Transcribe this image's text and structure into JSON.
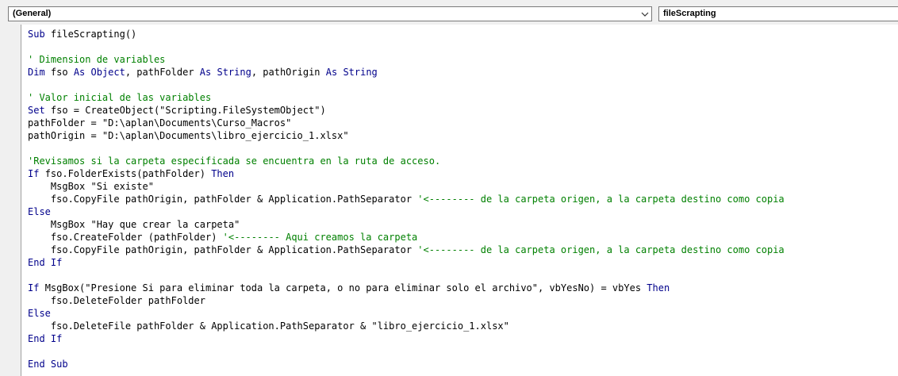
{
  "object_combo": {
    "value": "(General)"
  },
  "procedure_combo": {
    "value": "fileScrapting"
  },
  "code_lines": [
    [
      {
        "t": "Sub ",
        "c": "kw"
      },
      {
        "t": "fileScrapting()",
        "c": "p"
      }
    ],
    [],
    [
      {
        "t": "' Dimension de variables",
        "c": "cm"
      }
    ],
    [
      {
        "t": "Dim ",
        "c": "kw"
      },
      {
        "t": "fso ",
        "c": "p"
      },
      {
        "t": "As ",
        "c": "kw"
      },
      {
        "t": "Object",
        "c": "kw"
      },
      {
        "t": ", pathFolder ",
        "c": "p"
      },
      {
        "t": "As ",
        "c": "kw"
      },
      {
        "t": "String",
        "c": "kw"
      },
      {
        "t": ", pathOrigin ",
        "c": "p"
      },
      {
        "t": "As ",
        "c": "kw"
      },
      {
        "t": "String",
        "c": "kw"
      }
    ],
    [],
    [
      {
        "t": "' Valor inicial de las variables",
        "c": "cm"
      }
    ],
    [
      {
        "t": "Set ",
        "c": "kw"
      },
      {
        "t": "fso = CreateObject(\"Scripting.FileSystemObject\")",
        "c": "p"
      }
    ],
    [
      {
        "t": "pathFolder = \"D:\\aplan\\Documents\\Curso_Macros\"",
        "c": "p"
      }
    ],
    [
      {
        "t": "pathOrigin = \"D:\\aplan\\Documents\\libro_ejercicio_1.xlsx\"",
        "c": "p"
      }
    ],
    [],
    [
      {
        "t": "'Revisamos si la carpeta especificada se encuentra en la ruta de acceso.",
        "c": "cm"
      }
    ],
    [
      {
        "t": "If ",
        "c": "kw"
      },
      {
        "t": "fso.FolderExists(pathFolder) ",
        "c": "p"
      },
      {
        "t": "Then",
        "c": "kw"
      }
    ],
    [
      {
        "t": "    MsgBox \"Si existe\"",
        "c": "p"
      }
    ],
    [
      {
        "t": "    fso.CopyFile pathOrigin, pathFolder & Application.PathSeparator ",
        "c": "p"
      },
      {
        "t": "'<-------- de la carpeta origen, a la carpeta destino como copia",
        "c": "cm"
      }
    ],
    [
      {
        "t": "Else",
        "c": "kw"
      }
    ],
    [
      {
        "t": "    MsgBox \"Hay que crear la carpeta\"",
        "c": "p"
      }
    ],
    [
      {
        "t": "    fso.CreateFolder (pathFolder) ",
        "c": "p"
      },
      {
        "t": "'<-------- Aqui creamos la carpeta",
        "c": "cm"
      }
    ],
    [
      {
        "t": "    fso.CopyFile pathOrigin, pathFolder & Application.PathSeparator ",
        "c": "p"
      },
      {
        "t": "'<-------- de la carpeta origen, a la carpeta destino como copia",
        "c": "cm"
      }
    ],
    [
      {
        "t": "End If",
        "c": "kw"
      }
    ],
    [],
    [
      {
        "t": "If ",
        "c": "kw"
      },
      {
        "t": "MsgBox(\"Presione Si para eliminar toda la carpeta, o no para eliminar solo el archivo\", vbYesNo) = vbYes ",
        "c": "p"
      },
      {
        "t": "Then",
        "c": "kw"
      }
    ],
    [
      {
        "t": "    fso.DeleteFolder pathFolder",
        "c": "p"
      }
    ],
    [
      {
        "t": "Else",
        "c": "kw"
      }
    ],
    [
      {
        "t": "    fso.DeleteFile pathFolder & Application.PathSeparator & \"libro_ejercicio_1.xlsx\"",
        "c": "p"
      }
    ],
    [
      {
        "t": "End If",
        "c": "kw"
      }
    ],
    [],
    [
      {
        "t": "End Sub",
        "c": "kw"
      }
    ]
  ],
  "colors": {
    "keyword": "#00008b",
    "comment": "#008000",
    "plain": "#000000"
  },
  "icons": {
    "dropdown": "chevron-down-icon"
  }
}
